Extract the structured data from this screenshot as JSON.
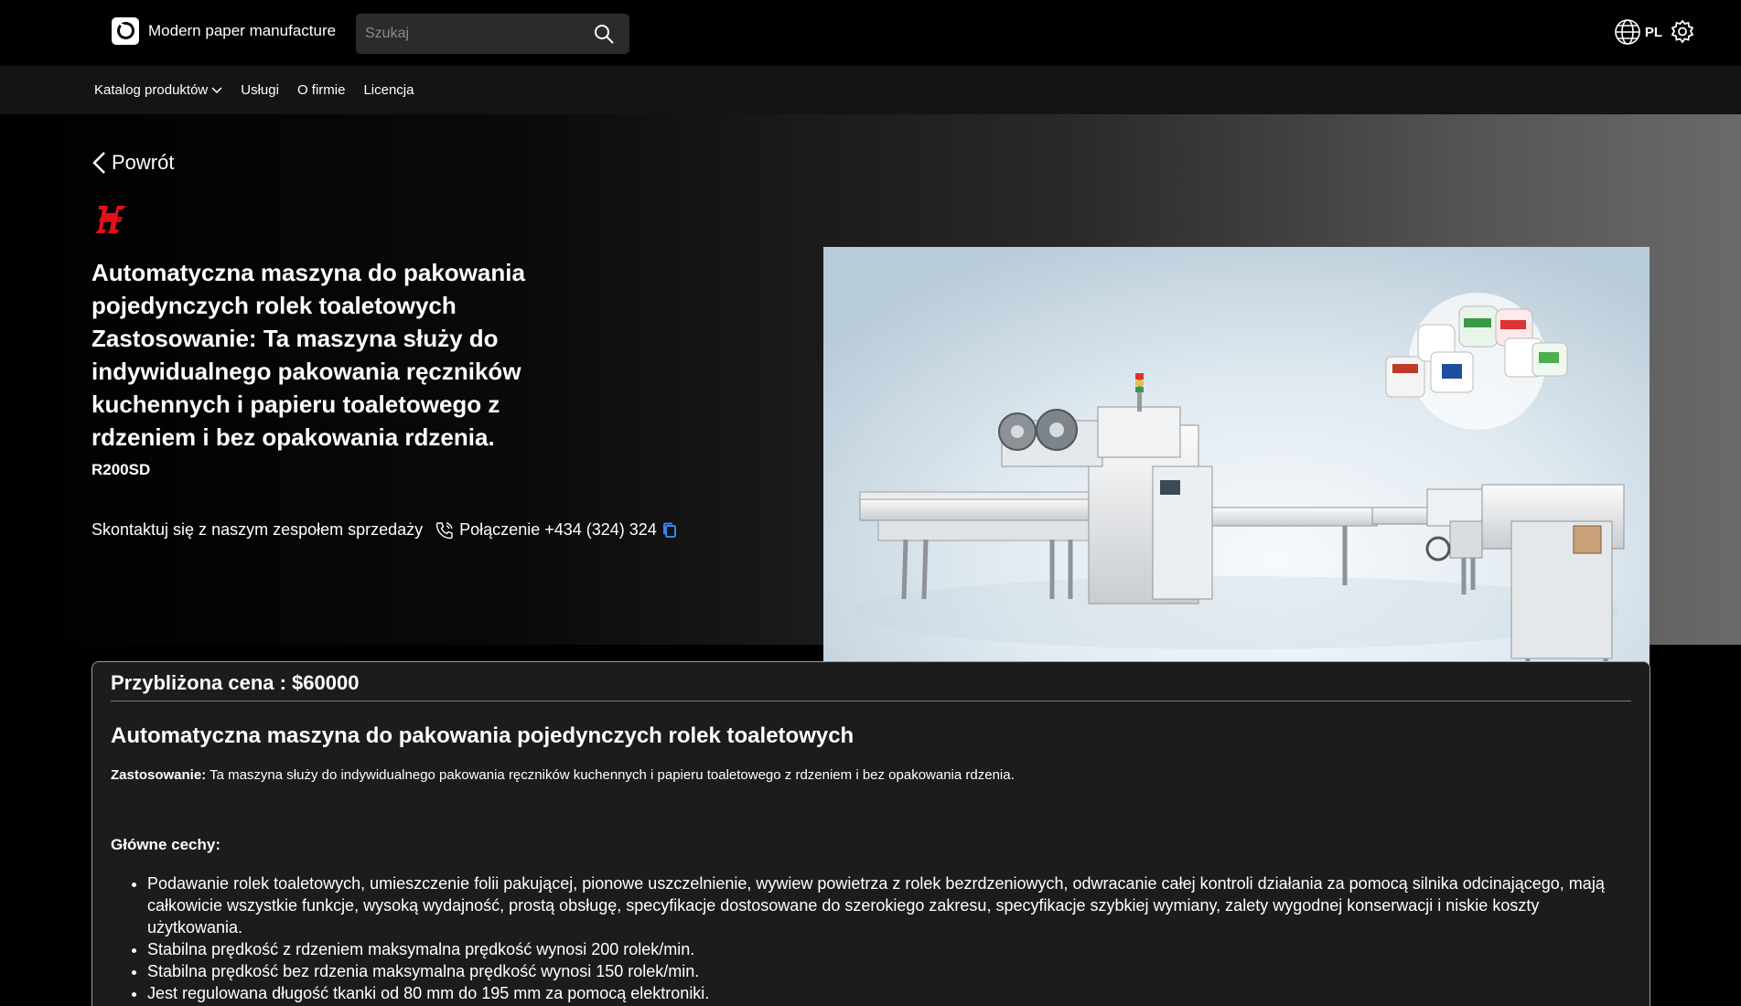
{
  "header": {
    "brand": "Modern paper manufacture",
    "search_placeholder": "Szukaj",
    "language": "PL"
  },
  "nav": {
    "items": [
      {
        "label": "Katalog produktów",
        "has_dropdown": true
      },
      {
        "label": "Usługi"
      },
      {
        "label": "O firmie"
      },
      {
        "label": "Licencja"
      }
    ]
  },
  "hero": {
    "back_label": "Powrót",
    "title": "Automatyczna maszyna do pakowania pojedynczych rolek toaletowych Zastosowanie: Ta maszyna służy do indywidualnego pakowania ręczników kuchennych i papieru toaletowego z rdzeniem i bez opakowania rdzenia.",
    "model": "R200SD",
    "contact_text": "Skontaktuj się z naszym zespołem sprzedaży",
    "phone_label": "Połączenie +434 (324) 324"
  },
  "details": {
    "price": "Przybliżona cena : $60000",
    "title": "Automatyczna maszyna do pakowania pojedynczych rolek toaletowych",
    "usage_label": "Zastosowanie:",
    "usage_text": " Ta maszyna służy do indywidualnego pakowania ręczników kuchennych i papieru toaletowego z rdzeniem i bez opakowania rdzenia.",
    "features_heading": "Główne cechy:",
    "features": [
      "Podawanie rolek toaletowych, umieszczenie folii pakującej, pionowe uszczelnienie, wywiew powietrza z rolek bezrdzeniowych, odwracanie całej kontroli działania za pomocą silnika odcinającego, mają całkowicie wszystkie funkcje, wysoką wydajność, prostą obsługę, specyfikacje dostosowane do szerokiego zakresu, specyfikacje szybkiej wymiany, zalety wygodnej konserwacji i niskie koszty użytkowania.",
      "Stabilna prędkość z rdzeniem maksymalna prędkość wynosi 200 rolek/min.",
      "Stabilna prędkość bez rdzenia maksymalna prędkość wynosi 150 rolek/min.",
      "Jest regulowana długość tkanki od 80 mm do 195 mm za pomocą elektroniki."
    ]
  },
  "colors": {
    "accent_copy": "#3b82f6",
    "maker_logo_red": "#e3101a"
  }
}
